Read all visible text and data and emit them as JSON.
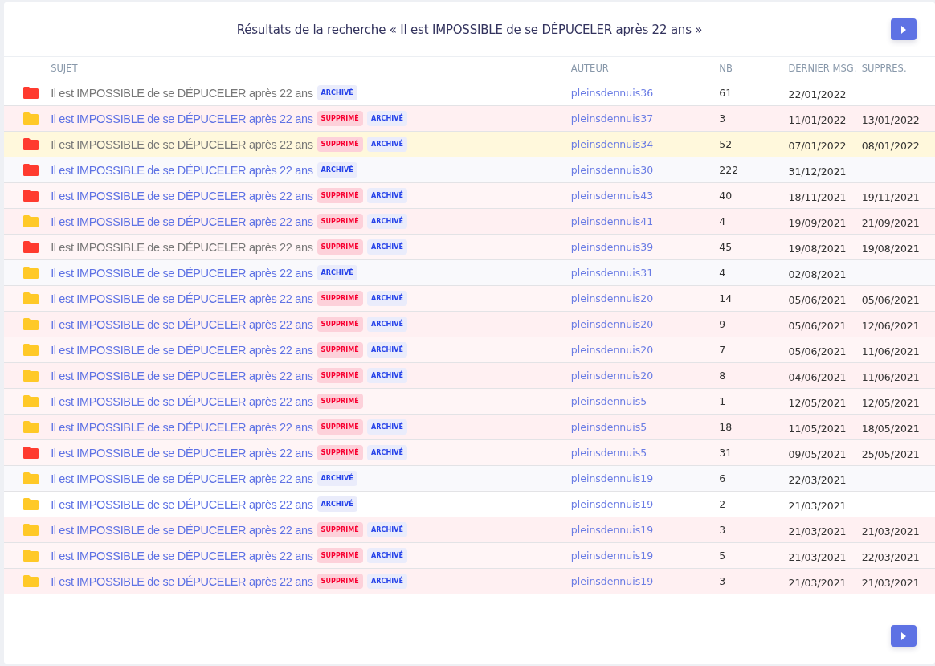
{
  "title": "Résultats de la recherche « Il est IMPOSSIBLE de se DÉPUCELER après 22 ans »",
  "table": {
    "columns": [
      "SUJET",
      "AUTEUR",
      "NB",
      "DERNIER MSG.",
      "SUPPRES."
    ],
    "rows": [
      {
        "hot": true,
        "visited": true,
        "kind": "plain",
        "subject": "Il est IMPOSSIBLE de se DÉPUCELER après 22 ans",
        "badges": [
          {
            "kind": "archived",
            "label": "ARCHIVÉ"
          }
        ],
        "author": "pleinsdennuis36",
        "count": "61",
        "last": "22/01/2022"
      },
      {
        "hot": false,
        "visited": false,
        "kind": "deleted",
        "subject": "Il est IMPOSSIBLE de se DÉPUCELER après 22 ans",
        "badges": [
          {
            "kind": "deleted",
            "label": "SUPPRIMÉ"
          },
          {
            "kind": "archived",
            "label": "ARCHIVÉ"
          }
        ],
        "author": "pleinsdennuis37",
        "count": "3",
        "last": "11/01/2022",
        "deleted_on": "13/01/2022"
      },
      {
        "hot": true,
        "visited": true,
        "kind": "highlighted",
        "subject": "Il est IMPOSSIBLE de se DÉPUCELER après 22 ans",
        "badges": [
          {
            "kind": "deleted",
            "label": "SUPPRIMÉ"
          },
          {
            "kind": "archived",
            "label": "ARCHIVÉ"
          }
        ],
        "author": "pleinsdennuis34",
        "count": "52",
        "last": "07/01/2022",
        "deleted_on": "08/01/2022"
      },
      {
        "hot": true,
        "visited": false,
        "kind": "plain",
        "subject": "Il est IMPOSSIBLE de se DÉPUCELER après 22 ans",
        "badges": [
          {
            "kind": "archived",
            "label": "ARCHIVÉ"
          }
        ],
        "author": "pleinsdennuis30",
        "count": "222",
        "last": "31/12/2021"
      },
      {
        "hot": true,
        "visited": false,
        "kind": "deleted",
        "subject": "Il est IMPOSSIBLE de se DÉPUCELER après 22 ans",
        "badges": [
          {
            "kind": "deleted",
            "label": "SUPPRIMÉ"
          },
          {
            "kind": "archived",
            "label": "ARCHIVÉ"
          }
        ],
        "author": "pleinsdennuis43",
        "count": "40",
        "last": "18/11/2021",
        "deleted_on": "19/11/2021"
      },
      {
        "hot": false,
        "visited": false,
        "kind": "deleted",
        "subject": "Il est IMPOSSIBLE de se DÉPUCELER après 22 ans",
        "badges": [
          {
            "kind": "deleted",
            "label": "SUPPRIMÉ"
          },
          {
            "kind": "archived",
            "label": "ARCHIVÉ"
          }
        ],
        "author": "pleinsdennuis41",
        "count": "4",
        "last": "19/09/2021",
        "deleted_on": "21/09/2021"
      },
      {
        "hot": true,
        "visited": true,
        "kind": "deleted",
        "subject": "Il est IMPOSSIBLE de se DÉPUCELER après 22 ans",
        "badges": [
          {
            "kind": "deleted",
            "label": "SUPPRIMÉ"
          },
          {
            "kind": "archived",
            "label": "ARCHIVÉ"
          }
        ],
        "author": "pleinsdennuis39",
        "count": "45",
        "last": "19/08/2021",
        "deleted_on": "19/08/2021"
      },
      {
        "hot": false,
        "visited": false,
        "kind": "plain",
        "subject": "Il est IMPOSSIBLE de se DÉPUCELER après 22 ans",
        "badges": [
          {
            "kind": "archived",
            "label": "ARCHIVÉ"
          }
        ],
        "author": "pleinsdennuis31",
        "count": "4",
        "last": "02/08/2021"
      },
      {
        "hot": false,
        "visited": false,
        "kind": "deleted",
        "subject": "Il est IMPOSSIBLE de se DÉPUCELER après 22 ans",
        "badges": [
          {
            "kind": "deleted",
            "label": "SUPPRIMÉ"
          },
          {
            "kind": "archived",
            "label": "ARCHIVÉ"
          }
        ],
        "author": "pleinsdennuis20",
        "count": "14",
        "last": "05/06/2021",
        "deleted_on": "05/06/2021"
      },
      {
        "hot": false,
        "visited": false,
        "kind": "deleted",
        "subject": "Il est IMPOSSIBLE de se DÉPUCELER après 22 ans",
        "badges": [
          {
            "kind": "deleted",
            "label": "SUPPRIMÉ"
          },
          {
            "kind": "archived",
            "label": "ARCHIVÉ"
          }
        ],
        "author": "pleinsdennuis20",
        "count": "9",
        "last": "05/06/2021",
        "deleted_on": "12/06/2021"
      },
      {
        "hot": false,
        "visited": false,
        "kind": "deleted",
        "subject": "Il est IMPOSSIBLE de se DÉPUCELER après 22 ans",
        "badges": [
          {
            "kind": "deleted",
            "label": "SUPPRIMÉ"
          },
          {
            "kind": "archived",
            "label": "ARCHIVÉ"
          }
        ],
        "author": "pleinsdennuis20",
        "count": "7",
        "last": "05/06/2021",
        "deleted_on": "11/06/2021"
      },
      {
        "hot": false,
        "visited": false,
        "kind": "deleted",
        "subject": "Il est IMPOSSIBLE de se DÉPUCELER après 22 ans",
        "badges": [
          {
            "kind": "deleted",
            "label": "SUPPRIMÉ"
          },
          {
            "kind": "archived",
            "label": "ARCHIVÉ"
          }
        ],
        "author": "pleinsdennuis20",
        "count": "8",
        "last": "04/06/2021",
        "deleted_on": "11/06/2021"
      },
      {
        "hot": false,
        "visited": false,
        "kind": "deleted",
        "subject": "Il est IMPOSSIBLE de se DÉPUCELER après 22 ans",
        "badges": [
          {
            "kind": "deleted",
            "label": "SUPPRIMÉ"
          }
        ],
        "author": "pleinsdennuis5",
        "count": "1",
        "last": "12/05/2021",
        "deleted_on": "12/05/2021"
      },
      {
        "hot": false,
        "visited": false,
        "kind": "deleted",
        "subject": "Il est IMPOSSIBLE de se DÉPUCELER après 22 ans",
        "badges": [
          {
            "kind": "deleted",
            "label": "SUPPRIMÉ"
          },
          {
            "kind": "archived",
            "label": "ARCHIVÉ"
          }
        ],
        "author": "pleinsdennuis5",
        "count": "18",
        "last": "11/05/2021",
        "deleted_on": "18/05/2021"
      },
      {
        "hot": true,
        "visited": false,
        "kind": "deleted",
        "subject": "Il est IMPOSSIBLE de se DÉPUCELER après 22 ans",
        "badges": [
          {
            "kind": "deleted",
            "label": "SUPPRIMÉ"
          },
          {
            "kind": "archived",
            "label": "ARCHIVÉ"
          }
        ],
        "author": "pleinsdennuis5",
        "count": "31",
        "last": "09/05/2021",
        "deleted_on": "25/05/2021"
      },
      {
        "hot": false,
        "visited": false,
        "kind": "plain",
        "subject": "Il est IMPOSSIBLE de se DÉPUCELER après 22 ans",
        "badges": [
          {
            "kind": "archived",
            "label": "ARCHIVÉ"
          }
        ],
        "author": "pleinsdennuis19",
        "count": "6",
        "last": "22/03/2021"
      },
      {
        "hot": false,
        "visited": false,
        "kind": "plain",
        "subject": "Il est IMPOSSIBLE de se DÉPUCELER après 22 ans",
        "badges": [
          {
            "kind": "archived",
            "label": "ARCHIVÉ"
          }
        ],
        "author": "pleinsdennuis19",
        "count": "2",
        "last": "21/03/2021"
      },
      {
        "hot": false,
        "visited": false,
        "kind": "deleted",
        "subject": "Il est IMPOSSIBLE de se DÉPUCELER après 22 ans",
        "badges": [
          {
            "kind": "deleted",
            "label": "SUPPRIMÉ"
          },
          {
            "kind": "archived",
            "label": "ARCHIVÉ"
          }
        ],
        "author": "pleinsdennuis19",
        "count": "3",
        "last": "21/03/2021",
        "deleted_on": "21/03/2021"
      },
      {
        "hot": false,
        "visited": false,
        "kind": "deleted",
        "subject": "Il est IMPOSSIBLE de se DÉPUCELER après 22 ans",
        "badges": [
          {
            "kind": "deleted",
            "label": "SUPPRIMÉ"
          },
          {
            "kind": "archived",
            "label": "ARCHIVÉ"
          }
        ],
        "author": "pleinsdennuis19",
        "count": "5",
        "last": "21/03/2021",
        "deleted_on": "22/03/2021"
      },
      {
        "hot": false,
        "visited": false,
        "kind": "deleted",
        "subject": "Il est IMPOSSIBLE de se DÉPUCELER après 22 ans",
        "badges": [
          {
            "kind": "deleted",
            "label": "SUPPRIMÉ"
          },
          {
            "kind": "archived",
            "label": "ARCHIVÉ"
          }
        ],
        "author": "pleinsdennuis19",
        "count": "3",
        "last": "21/03/2021",
        "deleted_on": "21/03/2021"
      }
    ]
  }
}
